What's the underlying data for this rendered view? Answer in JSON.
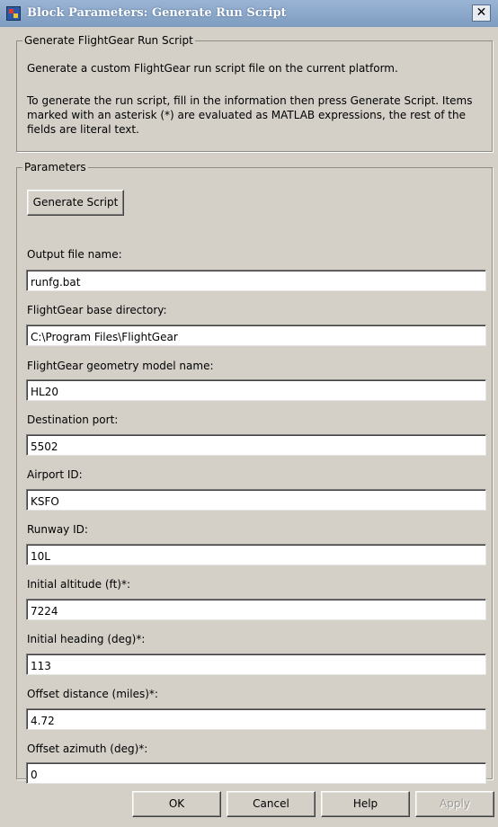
{
  "window": {
    "title": "Block Parameters: Generate Run Script",
    "close_glyph": "✕"
  },
  "description_group": {
    "legend": "Generate FlightGear Run Script",
    "text1": "Generate a custom FlightGear run script file on the current platform.",
    "text2": "To generate the run script, fill in the information then press Generate Script.  Items marked with an asterisk (*) are evaluated as MATLAB expressions, the rest of the fields are literal text."
  },
  "parameters_group": {
    "legend": "Parameters",
    "generate_button": "Generate Script",
    "fields": [
      {
        "label": "Output file name:",
        "value": "runfg.bat"
      },
      {
        "label": "FlightGear base directory:",
        "value": "C:\\Program Files\\FlightGear"
      },
      {
        "label": "FlightGear geometry model name:",
        "value": "HL20"
      },
      {
        "label": "Destination port:",
        "value": "5502"
      },
      {
        "label": "Airport ID:",
        "value": "KSFO"
      },
      {
        "label": "Runway ID:",
        "value": "10L"
      },
      {
        "label": "Initial altitude (ft)*:",
        "value": "7224"
      },
      {
        "label": "Initial heading (deg)*:",
        "value": "113"
      },
      {
        "label": "Offset distance (miles)*:",
        "value": "4.72"
      },
      {
        "label": "Offset azimuth (deg)*:",
        "value": "0"
      }
    ]
  },
  "buttons": {
    "ok": "OK",
    "cancel": "Cancel",
    "help": "Help",
    "apply": "Apply"
  }
}
